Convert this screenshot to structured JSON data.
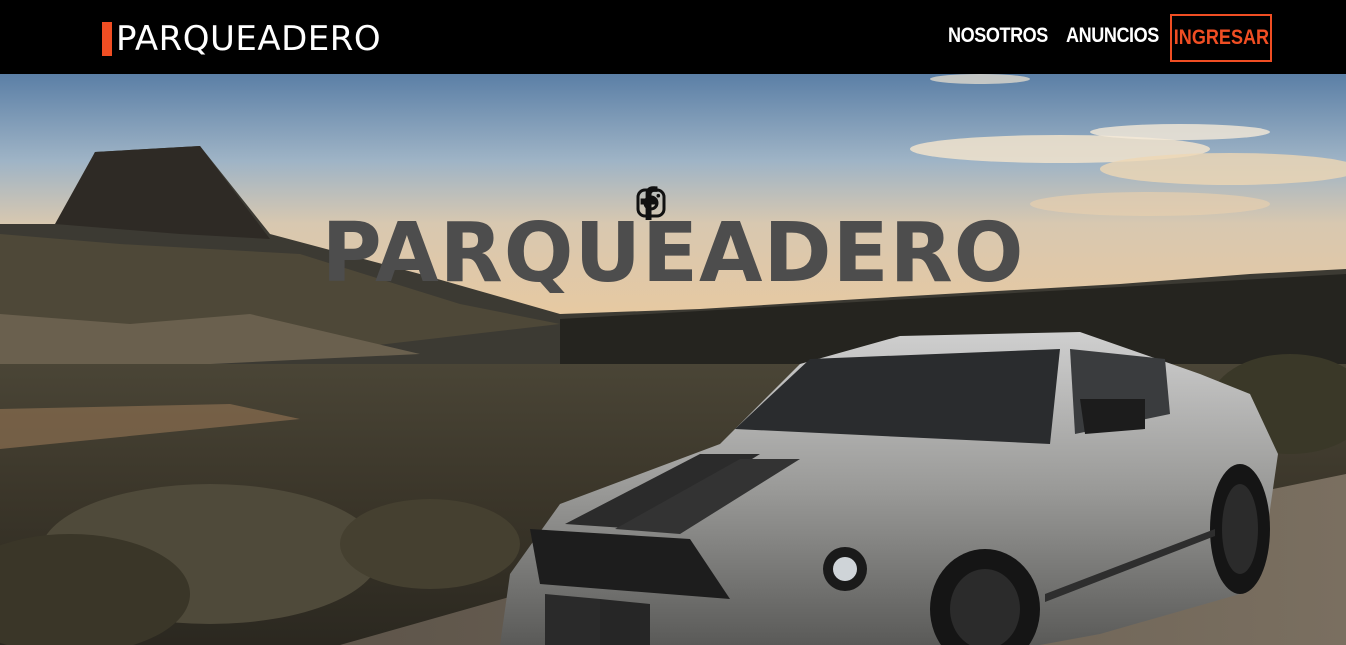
{
  "navbar": {
    "brand": "PARQUEADERO",
    "links": [
      {
        "label": "NOSOTROS"
      },
      {
        "label": "ANUNCIOS"
      }
    ],
    "login_label": "INGRESAR"
  },
  "hero": {
    "title": "PARQUEADERO",
    "social_icons": [
      "facebook-icon",
      "instagram-icon"
    ],
    "background": "desert landscape with silver sports car"
  },
  "colors": {
    "accent": "#f04e23",
    "navbar_bg": "#000000",
    "title": "#4d4d4d"
  }
}
